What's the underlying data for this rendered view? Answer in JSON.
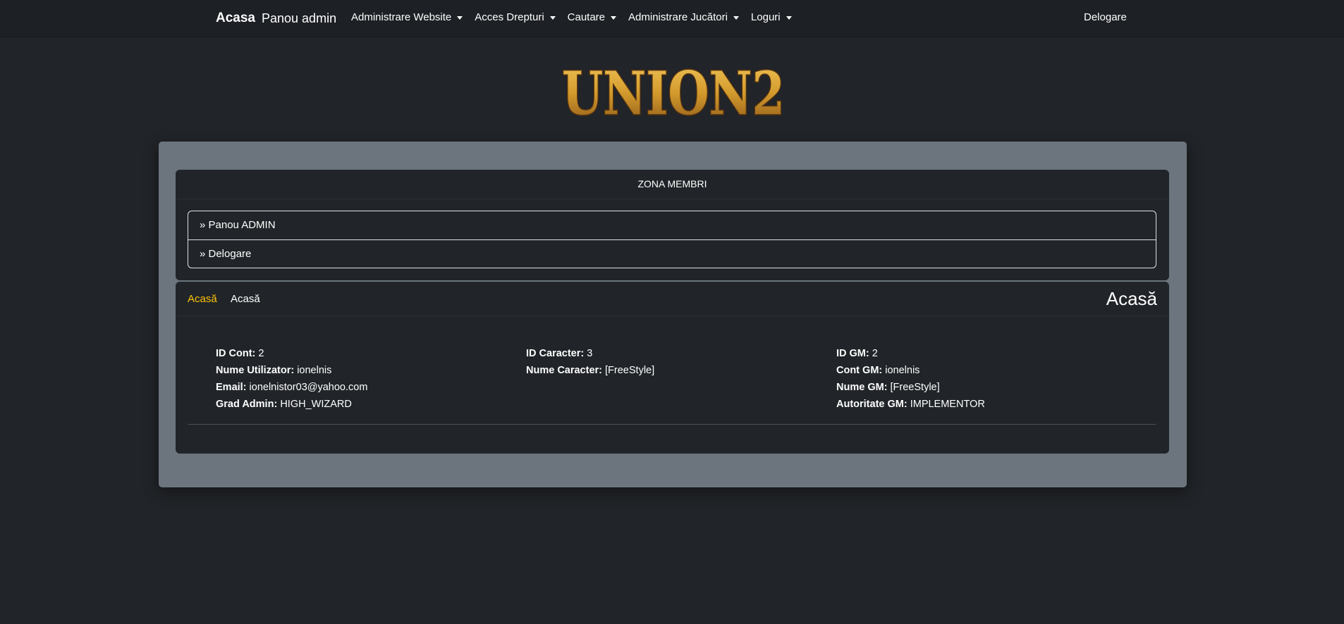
{
  "nav": {
    "brand": "Acasa",
    "admin_panel": "Panou admin",
    "menus": [
      {
        "label": "Administrare Website"
      },
      {
        "label": "Acces Drepturi"
      },
      {
        "label": "Cautare"
      },
      {
        "label": "Administrare Jucători"
      },
      {
        "label": "Loguri"
      }
    ],
    "logout": "Delogare"
  },
  "logo": {
    "text": "UNION2",
    "colors": {
      "gold": "#d39a2c",
      "dark": "#5a3510"
    }
  },
  "members": {
    "header": "ZONA MEMBRI",
    "items": [
      {
        "label": "» Panou ADMIN"
      },
      {
        "label": "» Delogare"
      }
    ]
  },
  "home": {
    "breadcrumb_active": "Acasă",
    "breadcrumb": "Acasă",
    "title": "Acasă",
    "account": {
      "id_label": "ID Cont:",
      "id_value": "2",
      "user_label": "Nume Utilizator:",
      "user_value": "ionelnis",
      "email_label": "Email:",
      "email_value": "ionelnistor03@yahoo.com",
      "grade_label": "Grad Admin:",
      "grade_value": "HIGH_WIZARD"
    },
    "character": {
      "id_label": "ID Caracter:",
      "id_value": "3",
      "name_label": "Nume Caracter:",
      "name_value": "[FreeStyle]"
    },
    "gm": {
      "id_label": "ID GM:",
      "id_value": "2",
      "account_label": "Cont GM:",
      "account_value": "ionelnis",
      "name_label": "Nume GM:",
      "name_value": "[FreeStyle]",
      "authority_label": "Autoritate GM:",
      "authority_value": "IMPLEMENTOR"
    }
  },
  "colors": {
    "accent": "#ffc107",
    "background": "#212428",
    "panel": "#6c757d",
    "card": "#212529"
  }
}
